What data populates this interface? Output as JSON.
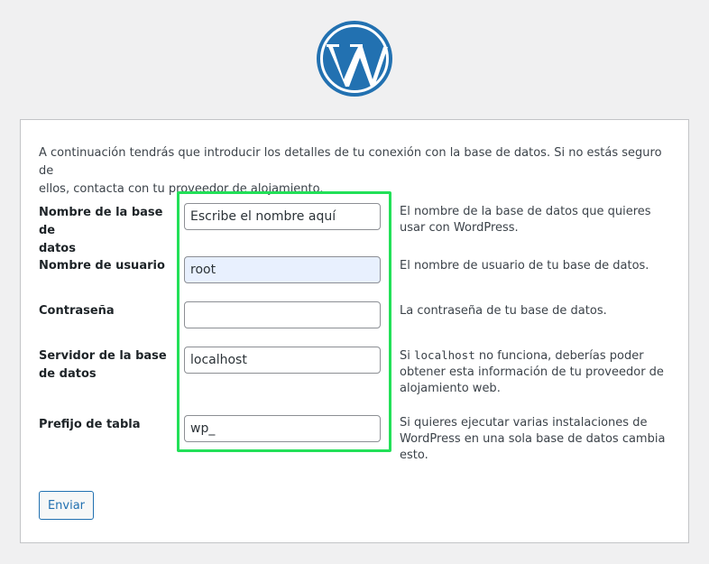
{
  "brand": {
    "logo_icon": "wordpress-logo-icon",
    "color": "#2271b1"
  },
  "intro": {
    "line1": "A continuación tendrás que introducir los detalles de tu conexión con la base de datos. Si no estás seguro de",
    "line2": "ellos, contacta con tu proveedor de alojamiento."
  },
  "form": {
    "dbname": {
      "label_line1": "Nombre de la base de",
      "label_line2": "datos",
      "value": "Escribe el nombre aquí",
      "desc_line1": "El nombre de la base de datos que quieres",
      "desc_line2": "usar con WordPress."
    },
    "username": {
      "label": "Nombre de usuario",
      "value": "root",
      "desc": "El nombre de usuario de tu base de datos."
    },
    "password": {
      "label": "Contraseña",
      "value": "",
      "desc": "La contraseña de tu base de datos."
    },
    "host": {
      "label_line1": "Servidor de la base",
      "label_line2": "de datos",
      "value": "localhost",
      "desc_pre": "Si ",
      "desc_code": "localhost",
      "desc_post": " no funciona, deberías poder",
      "desc_line2": "obtener esta información de tu proveedor de",
      "desc_line3": "alojamiento web."
    },
    "prefix": {
      "label": "Prefijo de tabla",
      "value": "wp_",
      "desc_line1": "Si quieres ejecutar varias instalaciones de",
      "desc_line2": "WordPress en una sola base de datos cambia",
      "desc_line3": "esto."
    },
    "highlight_color": "#22e058"
  },
  "submit": {
    "label": "Enviar"
  }
}
